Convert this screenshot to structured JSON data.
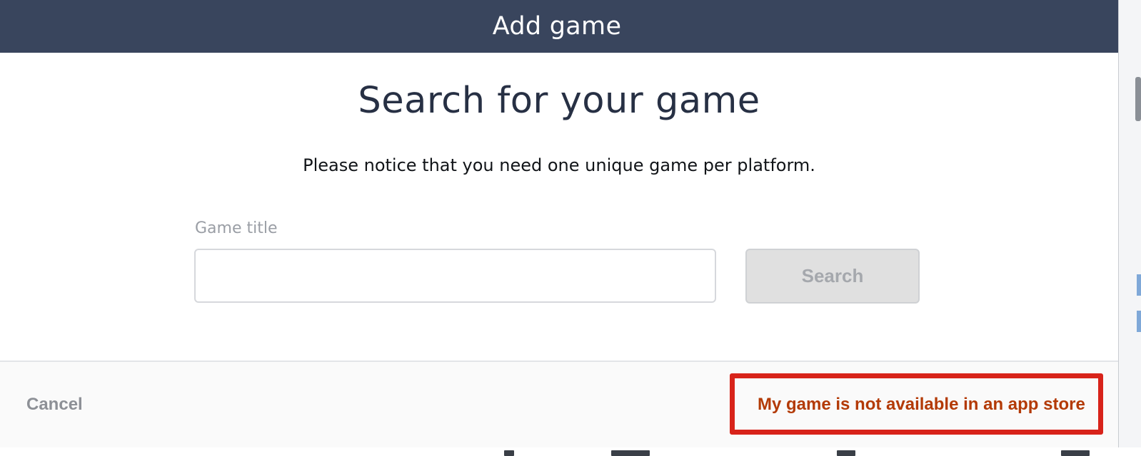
{
  "modal": {
    "header_title": "Add game",
    "heading": "Search for your game",
    "notice": "Please notice that you need one unique game per platform.",
    "game_title_label": "Game title",
    "game_title_value": "",
    "search_button_label": "Search"
  },
  "footer": {
    "cancel_label": "Cancel",
    "not_in_store_label": "My game is not available in an app store"
  },
  "colors": {
    "header_background": "#39455d",
    "highlight_border": "#d8231a",
    "link_text": "#b33a06"
  }
}
